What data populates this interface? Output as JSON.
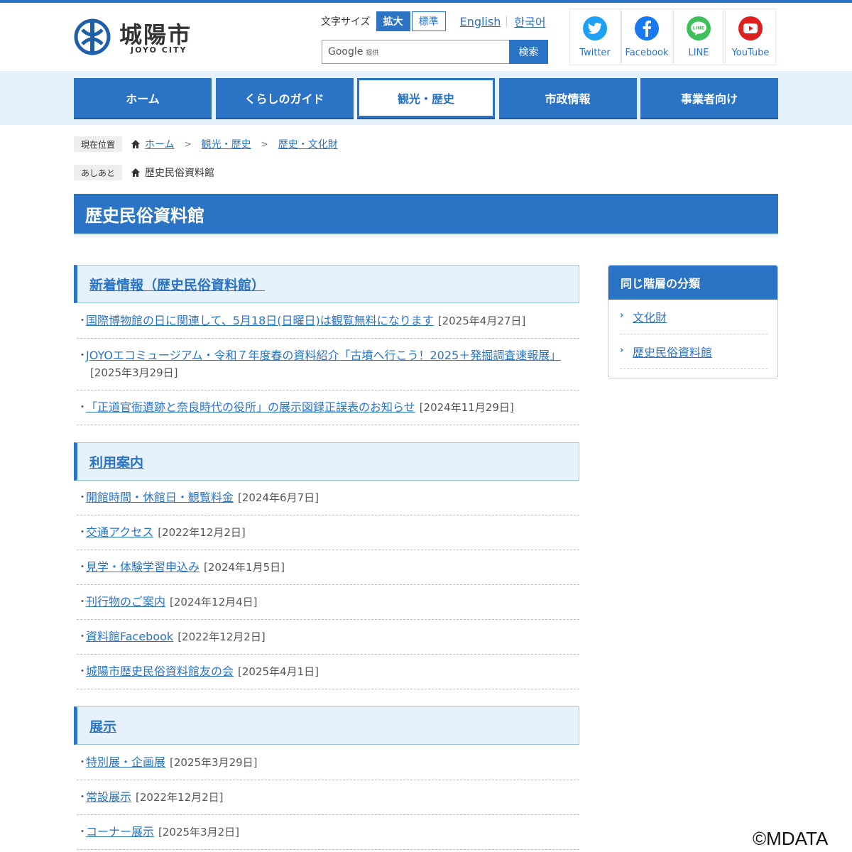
{
  "header": {
    "logo_title": "城陽市",
    "logo_sub": "JOYO CITY",
    "fontsize_label": "文字サイズ",
    "fontsize_large": "拡大",
    "fontsize_standard": "標準",
    "lang_en": "English",
    "lang_ko": "한국어",
    "search_provider": "Google",
    "search_provider_sub": "提供",
    "search_button": "検索",
    "social": [
      {
        "label": "Twitter",
        "icon": "twitter-icon",
        "color": "#1da1f2"
      },
      {
        "label": "Facebook",
        "icon": "facebook-icon",
        "color": "#1877f2"
      },
      {
        "label": "LINE",
        "icon": "line-icon",
        "color": "#3fbf5a"
      },
      {
        "label": "YouTube",
        "icon": "youtube-icon",
        "color": "#e0201e"
      }
    ]
  },
  "gnav": [
    "ホーム",
    "くらしのガイド",
    "観光・歴史",
    "市政情報",
    "事業者向け"
  ],
  "gnav_active": "観光・歴史",
  "breadcrumb": {
    "tag": "現在位置",
    "items": [
      "ホーム",
      "観光・歴史",
      "歴史・文化財"
    ]
  },
  "ashiato": {
    "tag": "あしあと",
    "item": "歴史民俗資料館"
  },
  "page_title": "歴史民俗資料館",
  "sections": [
    {
      "title": "新着情報（歴史民俗資料館）",
      "items": [
        {
          "label": "国際博物館の日に関連して、5月18日(日曜日)は観覧無料になります",
          "date": "[2025年4月27日]"
        },
        {
          "label": "JOYOエコミュージアム・令和７年度春の資料紹介「古墳へ行こう！2025＋発掘調査速報展」",
          "date": "[2025年3月29日]"
        },
        {
          "label": "「正道官衙遺跡と奈良時代の役所」の展示図録正誤表のお知らせ",
          "date": "[2024年11月29日]"
        }
      ]
    },
    {
      "title": "利用案内",
      "items": [
        {
          "label": "開館時間・休館日・観覧料金",
          "date": "[2024年6月7日]"
        },
        {
          "label": "交通アクセス",
          "date": "[2022年12月2日]"
        },
        {
          "label": "見学・体験学習申込み",
          "date": "[2024年1月5日]"
        },
        {
          "label": "刊行物のご案内",
          "date": "[2024年12月4日]"
        },
        {
          "label": "資料館Facebook",
          "date": "[2022年12月2日]"
        },
        {
          "label": "城陽市歴史民俗資料館友の会",
          "date": "[2025年4月1日]"
        }
      ]
    },
    {
      "title": "展示",
      "items": [
        {
          "label": "特別展・企画展",
          "date": "[2025年3月29日]"
        },
        {
          "label": "常設展示",
          "date": "[2022年12月2日]"
        },
        {
          "label": "コーナー展示",
          "date": "[2025年3月2日]"
        }
      ]
    }
  ],
  "sidebar": {
    "title": "同じ階層の分類",
    "items": [
      "文化財",
      "歴史民俗資料館"
    ]
  },
  "watermark": "©MDATA",
  "colors": {
    "accent": "#2a73c5",
    "band": "#e5f1fb"
  }
}
